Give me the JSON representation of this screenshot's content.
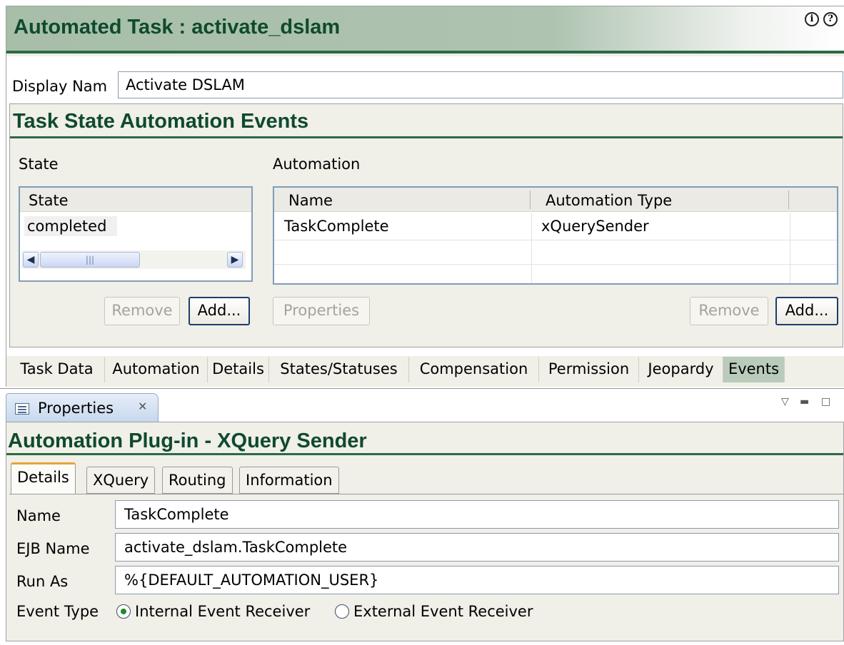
{
  "editor": {
    "title": "Automated Task : activate_dslam",
    "info_icon": "info-icon",
    "help_icon": "help-icon",
    "display_name_label": "Display Nam",
    "display_name_value": "Activate DSLAM"
  },
  "events_section": {
    "title": "Task State Automation Events",
    "state_label": "State",
    "automation_label": "Automation",
    "state_table": {
      "header": "State",
      "rows": [
        "completed"
      ]
    },
    "automation_table": {
      "columns": [
        "Name",
        "Automation Type"
      ],
      "rows": [
        {
          "name": "TaskComplete",
          "type": "xQuerySender"
        }
      ]
    },
    "state_buttons": {
      "remove": "Remove",
      "add": "Add..."
    },
    "automation_buttons": {
      "properties": "Properties",
      "remove": "Remove",
      "add": "Add..."
    }
  },
  "editor_tabs": [
    "Task Data",
    "Automation",
    "Details",
    "States/Statuses",
    "Compensation",
    "Permission",
    "Jeopardy",
    "Events"
  ],
  "editor_active_tab": "Events",
  "properties_view": {
    "tab_label": "Properties",
    "title": "Automation Plug-in - XQuery Sender",
    "tabs": [
      "Details",
      "XQuery",
      "Routing",
      "Information"
    ],
    "active_tab": "Details",
    "fields": {
      "name_label": "Name",
      "name_value": "TaskComplete",
      "ejb_label": "EJB Name",
      "ejb_value": "activate_dslam.TaskComplete",
      "runas_label": "Run As",
      "runas_value": "%{DEFAULT_AUTOMATION_USER}"
    },
    "event_type": {
      "label": "Event Type",
      "options": [
        "Internal Event Receiver",
        "External Event Receiver"
      ],
      "selected": "Internal Event Receiver"
    }
  },
  "colors": {
    "title_green": "#0f4a2e",
    "rule_green": "#2b6a46",
    "panel_bg": "#f0efe8",
    "active_tab": "#b9cbbb"
  }
}
